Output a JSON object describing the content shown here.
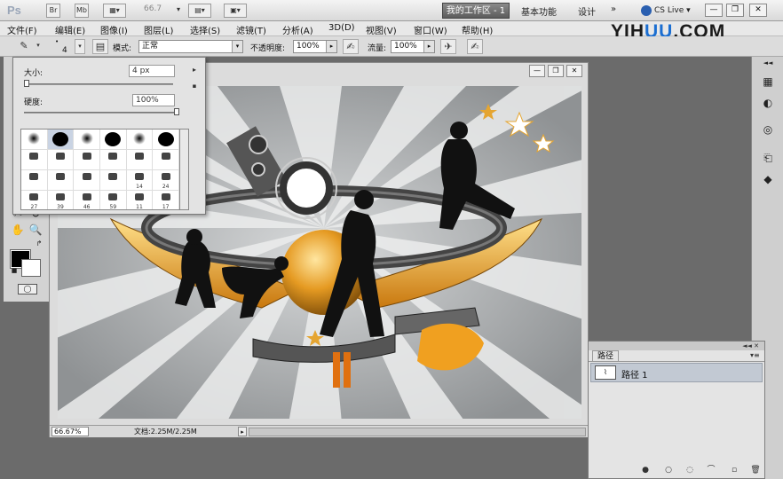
{
  "app": {
    "logo": "Ps",
    "zoom_value": "66.7"
  },
  "workspace": {
    "active": "我的工作区 - 1",
    "items": [
      "基本功能",
      "设计",
      "»"
    ],
    "cs_live": "CS Live"
  },
  "window_controls": [
    "—",
    "❐",
    "✕"
  ],
  "menu": [
    "文件(F)",
    "编辑(E)",
    "图像(I)",
    "图层(L)",
    "选择(S)",
    "滤镜(T)",
    "分析(A)",
    "3D(D)",
    "视图(V)",
    "窗口(W)",
    "帮助(H)"
  ],
  "watermark": {
    "part1": "YIH",
    "part2": "UU",
    "part3": ".COM"
  },
  "options": {
    "brush_size": "4",
    "mode_label": "模式:",
    "mode_value": "正常",
    "opacity_label": "不透明度:",
    "opacity_value": "100%",
    "flow_label": "流量:",
    "flow_value": "100%"
  },
  "brush_panel": {
    "size_label": "大小:",
    "size_value": "4 px",
    "hardness_label": "硬度:",
    "hardness_value": "100%",
    "size_fraction": 0.02,
    "hardness_fraction": 1.0,
    "presets": [
      "",
      "",
      "",
      "",
      "",
      "",
      "",
      "",
      "",
      "",
      "",
      "",
      "",
      "",
      "",
      "",
      "14",
      "24",
      "27",
      "39",
      "46",
      "59",
      "11",
      "17"
    ]
  },
  "document": {
    "zoom": "66.67%",
    "doc_info": "文档:2.25M/2.25M",
    "controls": [
      "—",
      "❐",
      "✕"
    ]
  },
  "paths_panel": {
    "tab": "路径",
    "collapse": "◄◄ ✕",
    "menu": "▾≡",
    "items": [
      "路径 1"
    ]
  },
  "icons": {
    "brush": "brush-icon",
    "airbrush": "airbrush-icon",
    "tablet": "tablet-pressure-icon"
  }
}
